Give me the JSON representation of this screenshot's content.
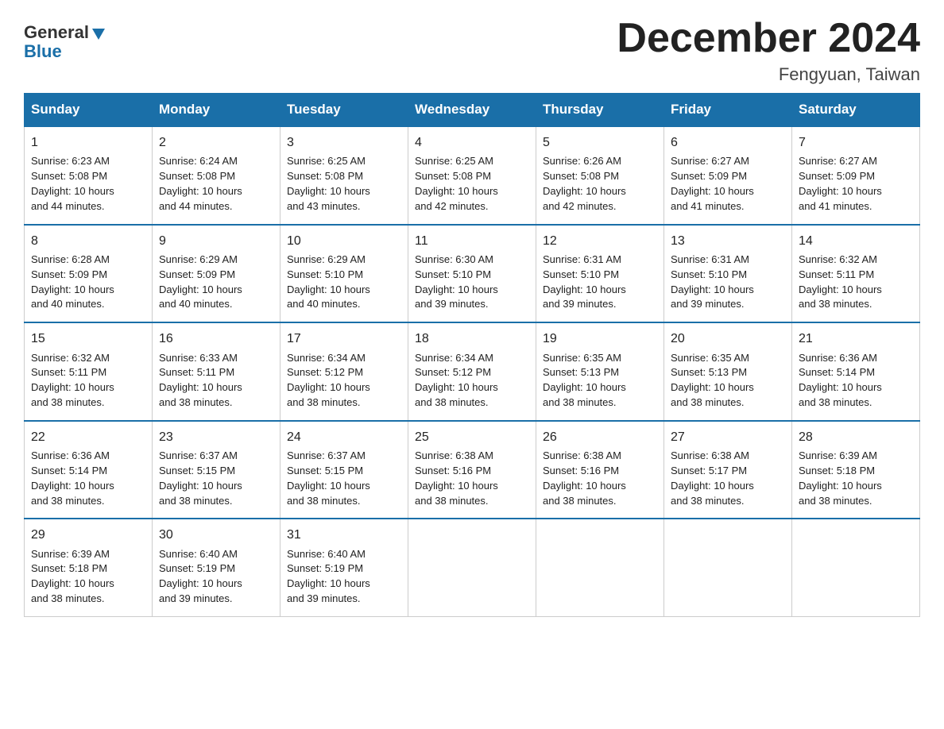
{
  "header": {
    "logo_general": "General",
    "logo_blue": "Blue",
    "month_title": "December 2024",
    "location": "Fengyuan, Taiwan"
  },
  "days_of_week": [
    "Sunday",
    "Monday",
    "Tuesday",
    "Wednesday",
    "Thursday",
    "Friday",
    "Saturday"
  ],
  "weeks": [
    [
      {
        "day": "1",
        "sunrise": "6:23 AM",
        "sunset": "5:08 PM",
        "daylight": "10 hours and 44 minutes."
      },
      {
        "day": "2",
        "sunrise": "6:24 AM",
        "sunset": "5:08 PM",
        "daylight": "10 hours and 44 minutes."
      },
      {
        "day": "3",
        "sunrise": "6:25 AM",
        "sunset": "5:08 PM",
        "daylight": "10 hours and 43 minutes."
      },
      {
        "day": "4",
        "sunrise": "6:25 AM",
        "sunset": "5:08 PM",
        "daylight": "10 hours and 42 minutes."
      },
      {
        "day": "5",
        "sunrise": "6:26 AM",
        "sunset": "5:08 PM",
        "daylight": "10 hours and 42 minutes."
      },
      {
        "day": "6",
        "sunrise": "6:27 AM",
        "sunset": "5:09 PM",
        "daylight": "10 hours and 41 minutes."
      },
      {
        "day": "7",
        "sunrise": "6:27 AM",
        "sunset": "5:09 PM",
        "daylight": "10 hours and 41 minutes."
      }
    ],
    [
      {
        "day": "8",
        "sunrise": "6:28 AM",
        "sunset": "5:09 PM",
        "daylight": "10 hours and 40 minutes."
      },
      {
        "day": "9",
        "sunrise": "6:29 AM",
        "sunset": "5:09 PM",
        "daylight": "10 hours and 40 minutes."
      },
      {
        "day": "10",
        "sunrise": "6:29 AM",
        "sunset": "5:10 PM",
        "daylight": "10 hours and 40 minutes."
      },
      {
        "day": "11",
        "sunrise": "6:30 AM",
        "sunset": "5:10 PM",
        "daylight": "10 hours and 39 minutes."
      },
      {
        "day": "12",
        "sunrise": "6:31 AM",
        "sunset": "5:10 PM",
        "daylight": "10 hours and 39 minutes."
      },
      {
        "day": "13",
        "sunrise": "6:31 AM",
        "sunset": "5:10 PM",
        "daylight": "10 hours and 39 minutes."
      },
      {
        "day": "14",
        "sunrise": "6:32 AM",
        "sunset": "5:11 PM",
        "daylight": "10 hours and 38 minutes."
      }
    ],
    [
      {
        "day": "15",
        "sunrise": "6:32 AM",
        "sunset": "5:11 PM",
        "daylight": "10 hours and 38 minutes."
      },
      {
        "day": "16",
        "sunrise": "6:33 AM",
        "sunset": "5:11 PM",
        "daylight": "10 hours and 38 minutes."
      },
      {
        "day": "17",
        "sunrise": "6:34 AM",
        "sunset": "5:12 PM",
        "daylight": "10 hours and 38 minutes."
      },
      {
        "day": "18",
        "sunrise": "6:34 AM",
        "sunset": "5:12 PM",
        "daylight": "10 hours and 38 minutes."
      },
      {
        "day": "19",
        "sunrise": "6:35 AM",
        "sunset": "5:13 PM",
        "daylight": "10 hours and 38 minutes."
      },
      {
        "day": "20",
        "sunrise": "6:35 AM",
        "sunset": "5:13 PM",
        "daylight": "10 hours and 38 minutes."
      },
      {
        "day": "21",
        "sunrise": "6:36 AM",
        "sunset": "5:14 PM",
        "daylight": "10 hours and 38 minutes."
      }
    ],
    [
      {
        "day": "22",
        "sunrise": "6:36 AM",
        "sunset": "5:14 PM",
        "daylight": "10 hours and 38 minutes."
      },
      {
        "day": "23",
        "sunrise": "6:37 AM",
        "sunset": "5:15 PM",
        "daylight": "10 hours and 38 minutes."
      },
      {
        "day": "24",
        "sunrise": "6:37 AM",
        "sunset": "5:15 PM",
        "daylight": "10 hours and 38 minutes."
      },
      {
        "day": "25",
        "sunrise": "6:38 AM",
        "sunset": "5:16 PM",
        "daylight": "10 hours and 38 minutes."
      },
      {
        "day": "26",
        "sunrise": "6:38 AM",
        "sunset": "5:16 PM",
        "daylight": "10 hours and 38 minutes."
      },
      {
        "day": "27",
        "sunrise": "6:38 AM",
        "sunset": "5:17 PM",
        "daylight": "10 hours and 38 minutes."
      },
      {
        "day": "28",
        "sunrise": "6:39 AM",
        "sunset": "5:18 PM",
        "daylight": "10 hours and 38 minutes."
      }
    ],
    [
      {
        "day": "29",
        "sunrise": "6:39 AM",
        "sunset": "5:18 PM",
        "daylight": "10 hours and 38 minutes."
      },
      {
        "day": "30",
        "sunrise": "6:40 AM",
        "sunset": "5:19 PM",
        "daylight": "10 hours and 39 minutes."
      },
      {
        "day": "31",
        "sunrise": "6:40 AM",
        "sunset": "5:19 PM",
        "daylight": "10 hours and 39 minutes."
      },
      null,
      null,
      null,
      null
    ]
  ],
  "labels": {
    "sunrise": "Sunrise:",
    "sunset": "Sunset:",
    "daylight": "Daylight:"
  }
}
